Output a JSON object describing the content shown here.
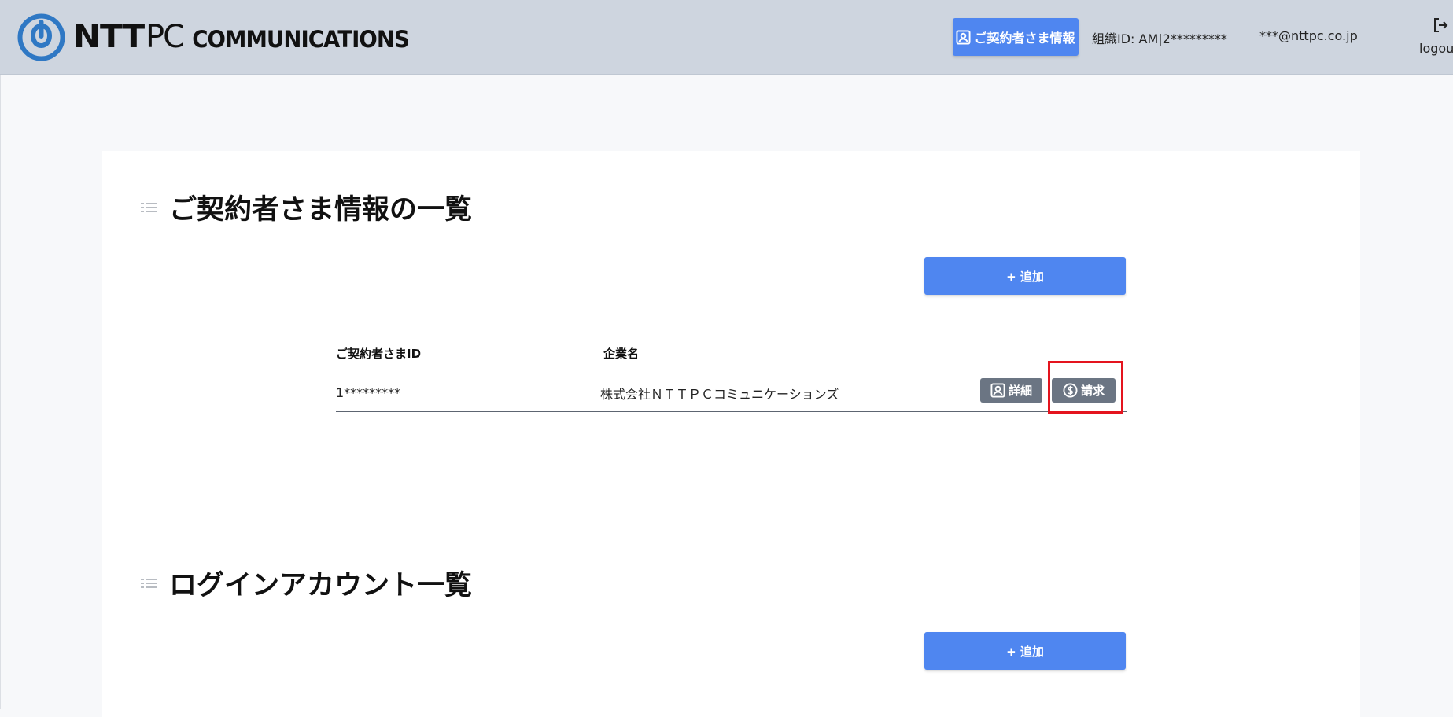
{
  "header": {
    "logo": {
      "ntt": "NTT",
      "pc": "PC",
      "communications": "COMMUNICATIONS"
    },
    "contract_button_label": "ご契約者さま情報",
    "org_id": "組織ID: AM|2*********",
    "email": "***@nttpc.co.jp",
    "logout_label": "logout"
  },
  "contractors_section": {
    "title": "ご契約者さま情報の一覧",
    "add_button_label": "+ 追加",
    "columns": [
      "ご契約者さまID",
      "企業名"
    ],
    "rows": [
      {
        "id": "1*********",
        "company": "株式会社ＮＴＴＰＣコミュニケーションズ",
        "detail_label": "詳細",
        "billing_label": "請求"
      }
    ]
  },
  "accounts_section": {
    "title": "ログインアカウント一覧",
    "add_button_label": "+ 追加"
  },
  "colors": {
    "primary_button": "#4f86f0",
    "row_button": "#6b7583",
    "header_bg": "#ced5df",
    "highlight": "#e4141e",
    "logo_blue": "#2f78c4"
  },
  "icons": {
    "logo_mark": "ntt-logo-icon",
    "contract": "user-card-icon",
    "logout": "logout-icon",
    "section": "list-icon",
    "detail": "user-card-icon",
    "billing": "dollar-circle-icon"
  }
}
